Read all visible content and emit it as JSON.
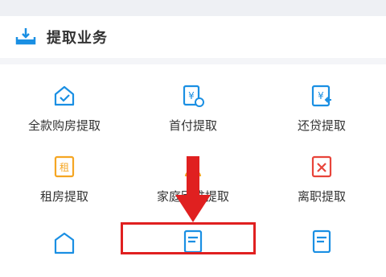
{
  "section": {
    "title": "提取业务",
    "icon": "withdraw-tray-icon"
  },
  "items": [
    {
      "label": "全款购房提取",
      "icon": "house-check-icon"
    },
    {
      "label": "首付提取",
      "icon": "yen-document-icon"
    },
    {
      "label": "还贷提取",
      "icon": "yen-return-icon"
    },
    {
      "label": "租房提取",
      "icon": "rent-tag-icon"
    },
    {
      "label": "家庭困难提取",
      "icon": "person-hardship-icon"
    },
    {
      "label": "离职提取",
      "icon": "resign-document-icon"
    },
    {
      "label": "",
      "icon": "yen-house-icon"
    },
    {
      "label": "",
      "icon": "list-document-icon"
    },
    {
      "label": "",
      "icon": "list-document-icon"
    }
  ],
  "colors": {
    "accent": "#1a8fe3",
    "orange": "#f5a623",
    "red": "#e02020",
    "text": "#333333"
  }
}
